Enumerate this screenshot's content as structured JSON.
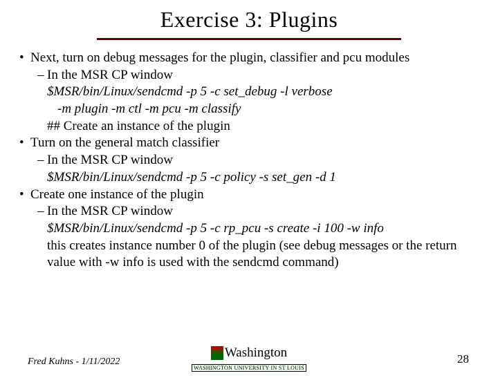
{
  "title": "Exercise 3: Plugins",
  "bullets": {
    "b1": "Next, turn on debug messages for the plugin, classifier and pcu modules",
    "b1_s1": "In the MSR CP window",
    "b1_cmd1": "$MSR/bin/Linux/sendcmd -p 5 -c set_debug -l verbose",
    "b1_cmd1b": "-m plugin -m ctl -m pcu -m classify",
    "b1_note": "## Create an instance of the plugin",
    "b2": "Turn on the general match classifier",
    "b2_s1": "In the MSR CP window",
    "b2_cmd1": "$MSR/bin/Linux/sendcmd -p 5 -c policy -s set_gen -d 1",
    "b3": "Create one instance of the plugin",
    "b3_s1": "In the MSR CP window",
    "b3_cmd1": "$MSR/bin/Linux/sendcmd -p 5 -c rp_pcu -s create -i 100 -w info",
    "b3_note": "this creates instance number 0 of the plugin (see debug messages or the return value with -w info is used with the sendcmd command)"
  },
  "footer": {
    "author": "Fred Kuhns - 1/11/2022",
    "university": "Washington",
    "subline": "WASHINGTON UNIVERSITY IN ST LOUIS",
    "page": "28"
  }
}
